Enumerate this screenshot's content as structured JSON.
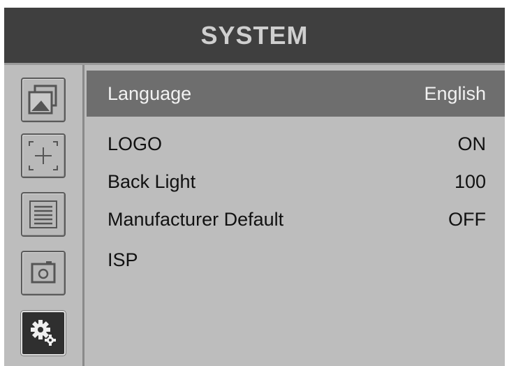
{
  "header": {
    "title": "SYSTEM"
  },
  "sidebar": {
    "items": [
      {
        "icon": "picture-icon",
        "selected": false
      },
      {
        "icon": "marker-crosshair-icon",
        "selected": false
      },
      {
        "icon": "list-icon",
        "selected": false
      },
      {
        "icon": "camera-icon",
        "selected": false
      },
      {
        "icon": "gear-settings-icon",
        "selected": true
      }
    ]
  },
  "menu": {
    "items": [
      {
        "label": "Language",
        "value": "English",
        "selected": true
      },
      {
        "label": "LOGO",
        "value": "ON",
        "selected": false
      },
      {
        "label": "Back Light",
        "value": "100",
        "selected": false
      },
      {
        "label": "Manufacturer Default",
        "value": "OFF",
        "selected": false
      },
      {
        "label": "ISP",
        "value": "",
        "selected": false
      }
    ]
  },
  "colors": {
    "header_bg": "#3f3f3f",
    "panel_bg": "#bdbdbd",
    "selected_row": "#6e6e6e"
  }
}
